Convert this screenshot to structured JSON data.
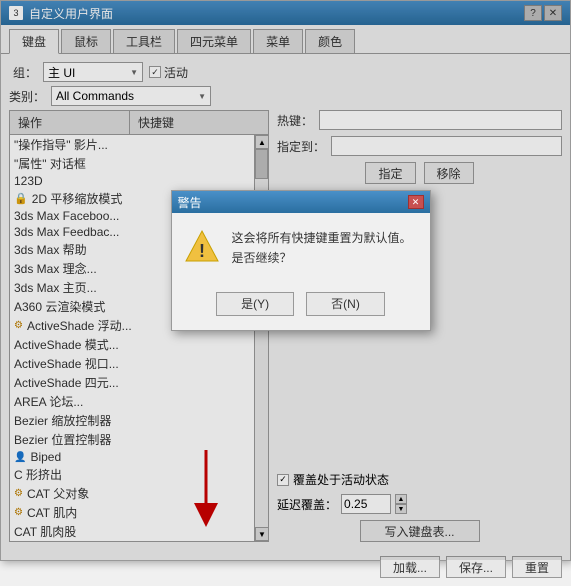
{
  "window": {
    "title": "自定义用户界面",
    "title_icon": "3"
  },
  "tabs": [
    {
      "label": "键盘",
      "active": true
    },
    {
      "label": "鼠标",
      "active": false
    },
    {
      "label": "工具栏",
      "active": false
    },
    {
      "label": "四元菜单",
      "active": false
    },
    {
      "label": "菜单",
      "active": false
    },
    {
      "label": "颜色",
      "active": false
    }
  ],
  "controls": {
    "group_label": "组：",
    "group_value": "主 UI",
    "active_label": "活动",
    "category_label": "类别：",
    "category_value": "All Commands"
  },
  "list": {
    "col_action": "操作",
    "col_shortcut": "快捷键",
    "items": [
      {
        "text": "\"操作指导\" 影片...",
        "icon": "",
        "indent": 0
      },
      {
        "text": "\"属性\" 对话框",
        "icon": "",
        "indent": 0
      },
      {
        "text": "123D",
        "icon": "",
        "indent": 0
      },
      {
        "text": "2D 平移缩放模式",
        "icon": "lock",
        "indent": 0
      },
      {
        "text": "3ds Max Faceboo...",
        "icon": "",
        "indent": 0
      },
      {
        "text": "3ds Max Feedbac...",
        "icon": "",
        "indent": 0
      },
      {
        "text": "3ds Max 帮助",
        "icon": "",
        "indent": 0
      },
      {
        "text": "3ds Max 理念...",
        "icon": "",
        "indent": 0
      },
      {
        "text": "3ds Max 主页...",
        "icon": "",
        "indent": 0
      },
      {
        "text": "A360 云渲染模式",
        "icon": "",
        "indent": 0
      },
      {
        "text": "ActiveShade 浮动...",
        "icon": "plugin",
        "indent": 0
      },
      {
        "text": "ActiveShade 模式...",
        "icon": "",
        "indent": 0
      },
      {
        "text": "ActiveShade 视口...",
        "icon": "",
        "indent": 0
      },
      {
        "text": "ActiveShade 四元...",
        "icon": "",
        "indent": 0
      },
      {
        "text": "AREA 论坛...",
        "icon": "",
        "indent": 0
      },
      {
        "text": "Bezier 缩放控制器",
        "icon": "",
        "indent": 0
      },
      {
        "text": "Bezier 位置控制器",
        "icon": "",
        "indent": 0
      },
      {
        "text": "Biped",
        "icon": "biped",
        "indent": 0
      },
      {
        "text": "C 形挤出",
        "icon": "",
        "indent": 0
      },
      {
        "text": "CAT 父对象",
        "icon": "plugin",
        "indent": 0
      },
      {
        "text": "CAT 肌内",
        "icon": "plugin",
        "indent": 0
      },
      {
        "text": "CAT 肌肉股",
        "icon": "",
        "indent": 0
      }
    ]
  },
  "right_panel": {
    "hotkey_label": "热键：",
    "assign_to_label": "指定到：",
    "assign_btn": "指定",
    "remove_btn": "移除",
    "override_label": "覆盖处于活动状态",
    "delay_label": "延迟覆盖：",
    "delay_value": "0.25",
    "write_btn": "写入键盘表...",
    "load_btn": "加载...",
    "save_btn": "保存...",
    "reset_btn": "重置"
  },
  "dialog": {
    "title": "警告",
    "message_line1": "这会将所有快捷键重置为默认值。",
    "message_line2": "是否继续？",
    "yes_btn": "是(Y)",
    "no_btn": "否(N)"
  }
}
